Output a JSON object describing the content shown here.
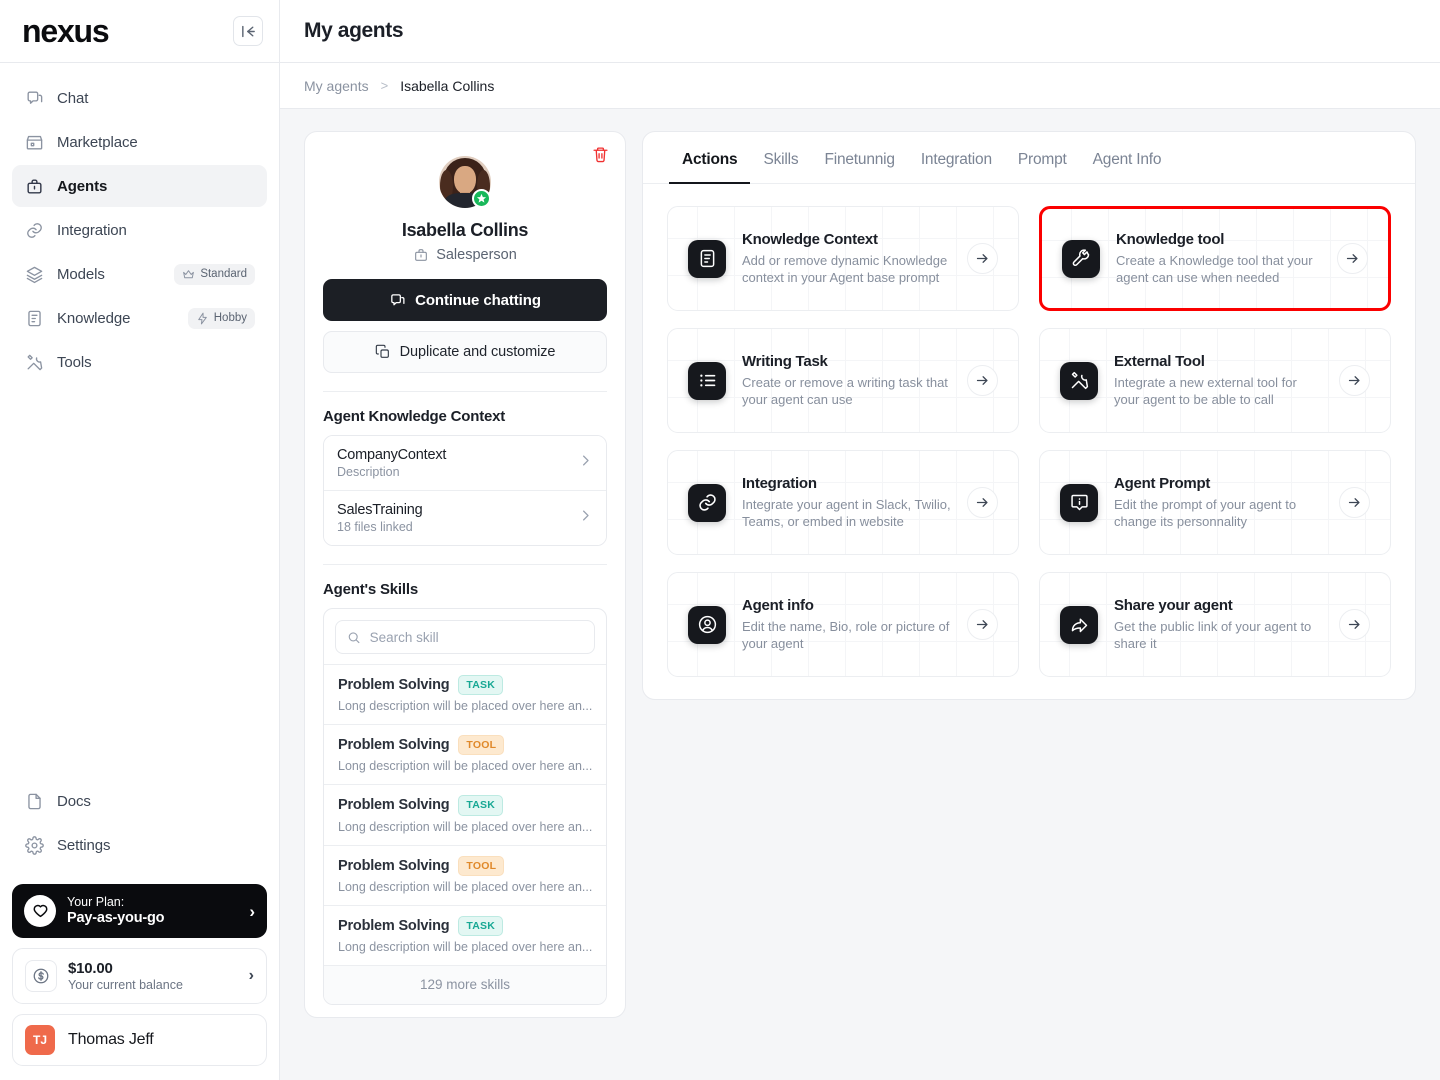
{
  "sidebar": {
    "logo": "nexus",
    "nav": [
      {
        "label": "Chat",
        "icon": "chat-icon"
      },
      {
        "label": "Marketplace",
        "icon": "store-icon"
      },
      {
        "label": "Agents",
        "icon": "briefcase-icon",
        "active": true
      },
      {
        "label": "Integration",
        "icon": "link-icon"
      },
      {
        "label": "Models",
        "icon": "layers-icon",
        "badge": "Standard",
        "badge_icon": "crown-icon"
      },
      {
        "label": "Knowledge",
        "icon": "document-icon",
        "badge": "Hobby",
        "badge_icon": "bolt-icon"
      },
      {
        "label": "Tools",
        "icon": "tools-icon"
      }
    ],
    "bottom_nav": [
      {
        "label": "Docs",
        "icon": "file-icon"
      },
      {
        "label": "Settings",
        "icon": "gear-icon"
      }
    ],
    "plan": {
      "label": "Your Plan:",
      "value": "Pay-as-you-go",
      "icon": "heart-icon"
    },
    "balance": {
      "amount": "$10.00",
      "caption": "Your current balance",
      "icon": "dollar-circle-icon"
    },
    "user": {
      "initials": "TJ",
      "name": "Thomas Jeff"
    }
  },
  "header": {
    "title": "My agents"
  },
  "breadcrumb": {
    "root": "My agents",
    "separator": ">",
    "current": "Isabella Collins"
  },
  "profile": {
    "name": "Isabella Collins",
    "role": "Salesperson",
    "continue_button": "Continue chatting",
    "duplicate_button": "Duplicate and customize",
    "knowledge_section_title": "Agent Knowledge Context",
    "knowledge_items": [
      {
        "title": "CompanyContext",
        "desc": "Description"
      },
      {
        "title": "SalesTraining",
        "desc": "18 files linked"
      }
    ],
    "skills_section_title": "Agent's Skills",
    "skill_search_placeholder": "Search skill",
    "skill_search_value": "",
    "skills": [
      {
        "name": "Problem Solving",
        "tag": "TASK",
        "desc": "Long description will be placed over here an..."
      },
      {
        "name": "Problem Solving",
        "tag": "TOOL",
        "desc": "Long description will be placed over here an..."
      },
      {
        "name": "Problem Solving",
        "tag": "TASK",
        "desc": "Long description will be placed over here an..."
      },
      {
        "name": "Problem Solving",
        "tag": "TOOL",
        "desc": "Long description will be placed over here an..."
      },
      {
        "name": "Problem Solving",
        "tag": "TASK",
        "desc": "Long description will be placed over here an..."
      }
    ],
    "more_skills": "129 more skills"
  },
  "tabs": [
    {
      "label": "Actions",
      "active": true
    },
    {
      "label": "Skills",
      "active": false
    },
    {
      "label": "Finetunnig",
      "active": false
    },
    {
      "label": "Integration",
      "active": false
    },
    {
      "label": "Prompt",
      "active": false
    },
    {
      "label": "Agent Info",
      "active": false
    }
  ],
  "actions": [
    {
      "title": "Knowledge Context",
      "desc": "Add or remove dynamic Knowledge context in your Agent base prompt",
      "icon": "document-lines-icon",
      "highlighted": false
    },
    {
      "title": "Knowledge tool",
      "desc": "Create a Knowledge tool that your agent can use when needed",
      "icon": "wrench-icon",
      "highlighted": true
    },
    {
      "title": "Writing Task",
      "desc": "Create or remove a writing task that your agent can use",
      "icon": "list-icon",
      "highlighted": false
    },
    {
      "title": "External Tool",
      "desc": "Integrate a new external tool for your agent to be able to call",
      "icon": "tools-cross-icon",
      "highlighted": false
    },
    {
      "title": "Integration",
      "desc": "Integrate your agent in Slack, Twilio, Teams, or embed in website",
      "icon": "link-icon",
      "highlighted": false
    },
    {
      "title": "Agent Prompt",
      "desc": "Edit the prompt of your agent to change its personnality",
      "icon": "prompt-bubble-icon",
      "highlighted": false
    },
    {
      "title": "Agent info",
      "desc": "Edit the name, Bio, role or picture of your agent",
      "icon": "user-circle-icon",
      "highlighted": false
    },
    {
      "title": "Share your agent",
      "desc": "Get the public link of your agent to share it",
      "icon": "share-arrow-icon",
      "highlighted": false
    }
  ],
  "colors": {
    "accent_highlight": "#fb0000",
    "dark": "#16181d",
    "tag_task_bg": "#e3f7f3",
    "tag_task_fg": "#17a894",
    "tag_tool_bg": "#fde9cf",
    "tag_tool_fg": "#e0892a",
    "verified_green": "#18b85a",
    "avatar_orange": "#ef6a4b"
  }
}
